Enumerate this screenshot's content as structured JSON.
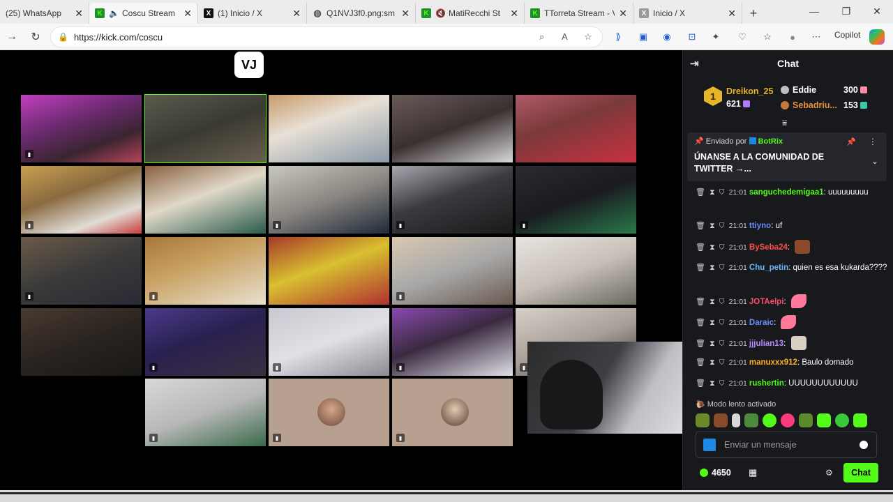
{
  "browser": {
    "tabs": [
      {
        "title": "(25) WhatsApp",
        "icon": "whatsapp-icon",
        "active": false
      },
      {
        "title": "Coscu Stream",
        "icon": "kick-icon",
        "active": true,
        "audio": true
      },
      {
        "title": "(1) Inicio / X",
        "icon": "x-icon",
        "active": false
      },
      {
        "title": "Q1NVJ3f0.png:sm",
        "icon": "globe-icon",
        "active": false
      },
      {
        "title": "MatiRecchi St",
        "icon": "kick-icon",
        "active": false,
        "muted": true
      },
      {
        "title": "TTorreta Stream - V",
        "icon": "kick-icon",
        "active": false
      },
      {
        "title": "Inicio / X",
        "icon": "x-icon",
        "active": false
      }
    ],
    "new_tab_label": "+",
    "url": "https://kick.com/coscu",
    "copilot_label": "Copilot"
  },
  "stream": {
    "logo_text": "VJ"
  },
  "chat": {
    "header": "Chat",
    "leaderboard": {
      "first": {
        "name": "Dreikon_25",
        "value": "621",
        "rank": "1"
      },
      "second": {
        "name": "Eddie",
        "value": "300"
      },
      "third": {
        "name": "Sebadriu...",
        "value": "153"
      }
    },
    "pinned": {
      "sent_by": "Enviado por",
      "bot_name": "BotRix",
      "message": "ÚNANSE A LA COMUNIDAD DE TWITTER →..."
    },
    "messages": [
      {
        "time": "21:01",
        "user": "sanguchedemigaa1",
        "color": "#53fc18",
        "text": "uuuuuuuuu"
      },
      {
        "time": "21:01",
        "user": "ttiyno",
        "color": "#6b8cff",
        "text": "uf"
      },
      {
        "time": "21:01",
        "user": "BySeba24",
        "color": "#ff4d4d",
        "text": ""
      },
      {
        "time": "21:01",
        "user": "Chu_petin",
        "color": "#6bb8ff",
        "text": "quien es esa kukarda????"
      },
      {
        "time": "21:01",
        "user": "JOTAelpi",
        "color": "#ff4d6d",
        "text": ""
      },
      {
        "time": "21:01",
        "user": "Daraic",
        "color": "#6b8cff",
        "text": ""
      },
      {
        "time": "21:01",
        "user": "jjjulian13",
        "color": "#b98cff",
        "text": ""
      },
      {
        "time": "21:01",
        "user": "manuxxx912",
        "color": "#ffb020",
        "text": "Baulo domado"
      },
      {
        "time": "21:01",
        "user": "rushertin",
        "color": "#53fc18",
        "text": "UUUUUUUUUUUU"
      }
    ],
    "slow_mode": "Modo lento activado",
    "input_placeholder": "Enviar un mensaje",
    "points": "4650",
    "send_label": "Chat"
  },
  "colors": {
    "kick_green": "#53fc18",
    "chat_bg": "#18191c",
    "gold": "#e7b52a"
  }
}
